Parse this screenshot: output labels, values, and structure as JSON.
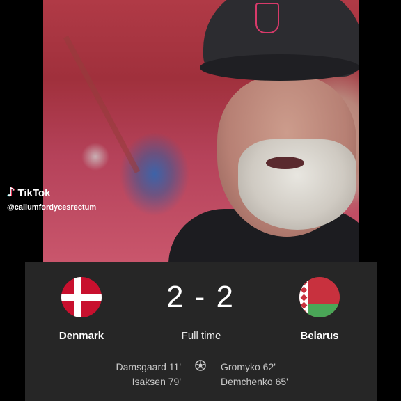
{
  "watermark": {
    "brand": "TikTok",
    "icon": "tiktok-note-icon",
    "handle": "@callumfordycesrectum"
  },
  "match": {
    "home": {
      "name": "Denmark",
      "flag": "denmark-flag-icon",
      "scorers": [
        "Damsgaard 11'",
        "Isaksen 79'"
      ]
    },
    "away": {
      "name": "Belarus",
      "flag": "belarus-flag-icon",
      "scorers": [
        "Gromyko 62'",
        "Demchenko 65'"
      ]
    },
    "score": "2 - 2",
    "status": "Full time",
    "goal_icon": "soccer-ball-icon"
  },
  "colors": {
    "card_bg": "#262626",
    "denmark_red": "#c8102e",
    "belarus_red": "#c8313e",
    "belarus_green": "#4aa657"
  }
}
